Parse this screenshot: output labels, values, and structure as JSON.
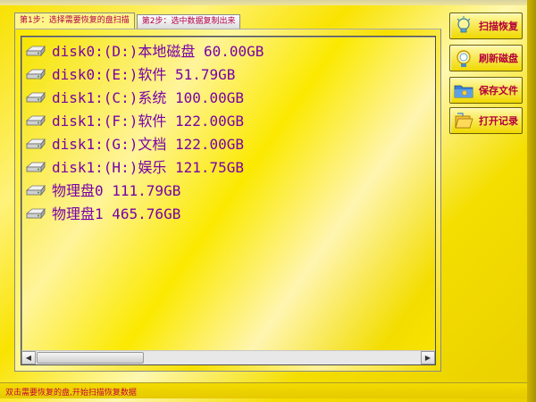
{
  "tabs": [
    {
      "label": "第1步：选择需要恢复的盘扫描",
      "active": true
    },
    {
      "label": "第2步：选中数据复制出来",
      "active": false
    }
  ],
  "disks": [
    {
      "label": "disk0:(D:)本地磁盘 60.00GB",
      "icon": "hard-drive-icon"
    },
    {
      "label": "disk0:(E:)软件 51.79GB",
      "icon": "hard-drive-icon"
    },
    {
      "label": "disk1:(C:)系统 100.00GB",
      "icon": "hard-drive-icon"
    },
    {
      "label": "disk1:(F:)软件 122.00GB",
      "icon": "hard-drive-icon"
    },
    {
      "label": "disk1:(G:)文档 122.00GB",
      "icon": "hard-drive-icon"
    },
    {
      "label": "disk1:(H:)娱乐 121.75GB",
      "icon": "hard-drive-icon"
    },
    {
      "label": "物理盘0 111.79GB",
      "icon": "hard-drive-icon"
    },
    {
      "label": "物理盘1 465.76GB",
      "icon": "hard-drive-icon"
    }
  ],
  "buttons": {
    "scan": {
      "label": "扫描恢复",
      "icon": "lightbulb-icon"
    },
    "refresh": {
      "label": "刷新磁盘",
      "icon": "magnifier-icon"
    },
    "save": {
      "label": "保存文件",
      "icon": "folder-icon"
    },
    "open": {
      "label": "打开记录",
      "icon": "open-folder-icon"
    }
  },
  "status": {
    "text": "双击需要恢复的盘,开始扫描恢复数据"
  },
  "colors": {
    "accent_text": "#7a00a8",
    "button_text": "#b5003a",
    "background": "#f7e100"
  }
}
